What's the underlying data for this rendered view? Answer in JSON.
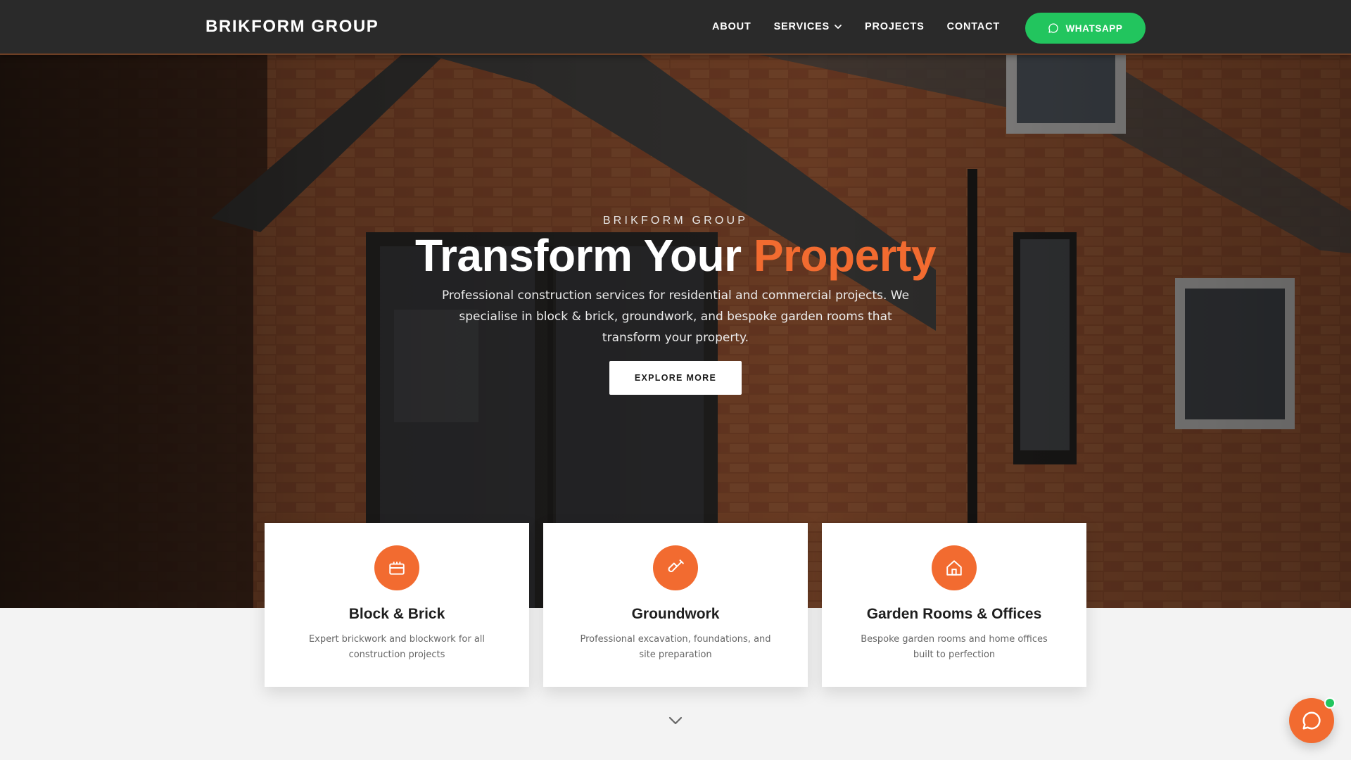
{
  "nav": {
    "brand": "BRIKFORM GROUP",
    "links": [
      {
        "label": "ABOUT"
      },
      {
        "label": "SERVICES",
        "icon": "chevron-down-icon"
      },
      {
        "label": "PROJECTS"
      },
      {
        "label": "CONTACT"
      }
    ],
    "whatsapp_label": "WHATSAPP",
    "whatsapp_icon": "chat-bubble-icon"
  },
  "hero": {
    "eyebrow": "BRIKFORM GROUP",
    "headline_main": "Transform Your",
    "headline_accent": "Property",
    "subtext": "Professional construction services for residential and commercial projects. We specialise in block & brick, groundwork, and bespoke garden rooms that transform your property.",
    "cta_label": "EXPLORE MORE"
  },
  "services": [
    {
      "icon": "brick-icon",
      "title": "Block & Brick",
      "description": "Expert brickwork and blockwork for all construction projects"
    },
    {
      "icon": "shovel-icon",
      "title": "Groundwork",
      "description": "Professional excavation, foundations, and site preparation"
    },
    {
      "icon": "house-icon",
      "title": "Garden Rooms & Offices",
      "description": "Bespoke garden rooms and home offices built to perfection"
    }
  ],
  "colors": {
    "accent": "#f26b30",
    "whatsapp": "#22c55e",
    "navbar": "#2a2a2a"
  },
  "scroll_icon": "chevron-down-icon",
  "chat_widget": {
    "icon": "chat-bubble-icon",
    "status": "online"
  }
}
